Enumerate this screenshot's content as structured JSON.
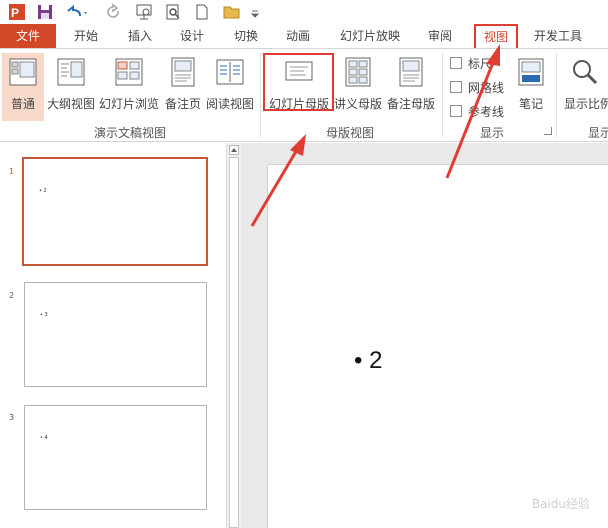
{
  "tabs": {
    "file": "文件",
    "home": "开始",
    "insert": "插入",
    "design": "设计",
    "transitions": "切换",
    "animations": "动画",
    "slideshow": "幻灯片放映",
    "review": "审阅",
    "view": "视图",
    "developer": "开发工具"
  },
  "ribbon": {
    "presentation_views": {
      "group_label": "演示文稿视图",
      "normal": "普通",
      "outline": "大纲视图",
      "slide_sorter": "幻灯片浏览",
      "notes_page": "备注页",
      "reading": "阅读视图"
    },
    "master_views": {
      "group_label": "母版视图",
      "slide_master": "幻灯片母版",
      "handout_master": "讲义母版",
      "notes_master": "备注母版"
    },
    "show": {
      "group_label": "显示",
      "ruler": "标尺",
      "gridlines": "网格线",
      "guides": "参考线",
      "notes": "笔记"
    },
    "zoom": {
      "label": "显示比例",
      "group_label": "显示"
    }
  },
  "slides": [
    {
      "number": "1",
      "text": "• 2"
    },
    {
      "number": "2",
      "text": "• 3"
    },
    {
      "number": "3",
      "text": "• 4"
    }
  ],
  "main_slide": {
    "text": "• 2"
  },
  "watermark": "Baidu经验",
  "colors": {
    "accent": "#d24726",
    "highlight": "#e03c31"
  }
}
